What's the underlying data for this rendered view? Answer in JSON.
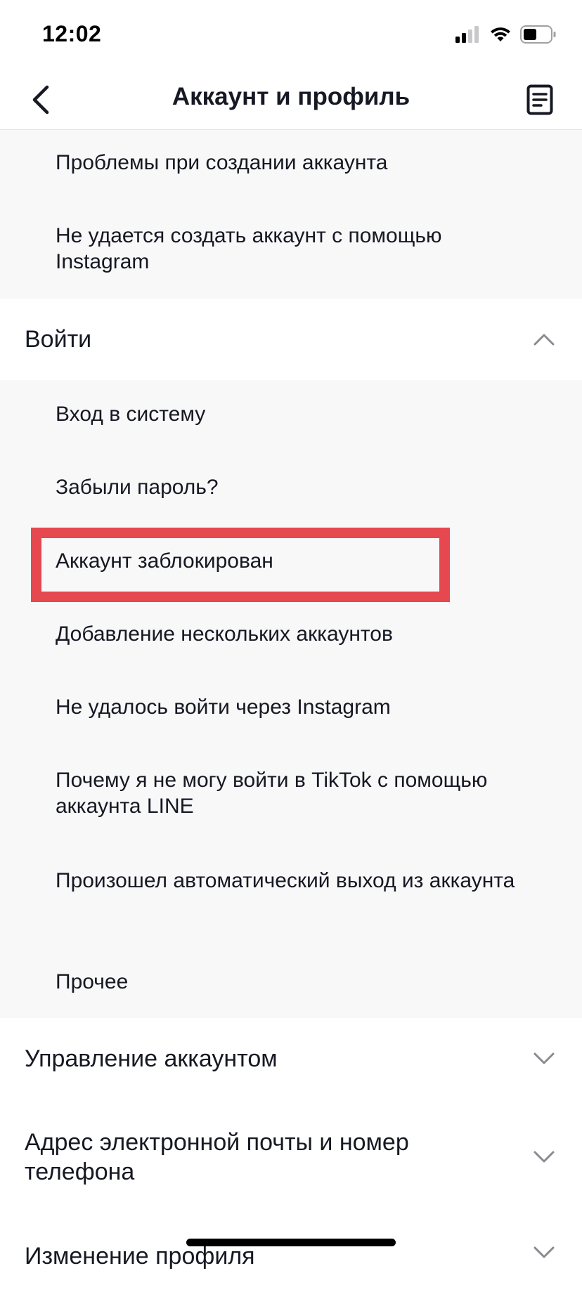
{
  "status": {
    "time": "12:02"
  },
  "header": {
    "title": "Аккаунт и профиль",
    "back_icon": "chevron-left-icon",
    "doc_icon": "document-icon"
  },
  "groups": {
    "creation_items": [
      "Проблемы при создании аккаунта",
      "Не удается создать аккаунт с помощью Instagram"
    ],
    "login": {
      "label": "Войти",
      "expanded": true,
      "items": [
        "Вход в систему",
        "Забыли пароль?",
        "Аккаунт заблокирован",
        "Добавление нескольких аккаунтов",
        "Не удалось войти через Instagram",
        "Почему я не могу войти в TikTok с помощью аккаунта LINE",
        "Произошел автоматический выход из аккаунта",
        "Прочее"
      ]
    },
    "collapsed_sections": [
      "Управление аккаунтом",
      "Адрес электронной почты и номер телефона",
      "Изменение профиля"
    ]
  },
  "colors": {
    "highlight": "#e5484f",
    "sub_background": "#f8f8f8",
    "text": "#161823"
  }
}
